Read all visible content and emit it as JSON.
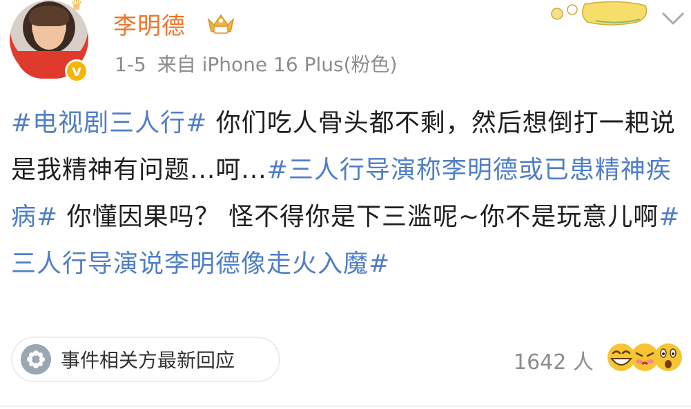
{
  "post": {
    "author": {
      "name": "李明德",
      "verified": true
    },
    "meta": {
      "time": "1-5",
      "source": "来自 iPhone 16 Plus(粉色)"
    },
    "segments": [
      {
        "type": "hashtag",
        "text": "#电视剧三人行#"
      },
      {
        "type": "text",
        "text": " 你们吃人骨头都不剩，然后想倒打一耙说是我精神有问题...呵..."
      },
      {
        "type": "hashtag",
        "text": "#三人行导演称李明德或已患精神疾病#"
      },
      {
        "type": "text",
        "text": " 你懂因果吗？ 怪不得你是下三滥呢~你不是玩意儿啊"
      },
      {
        "type": "hashtag",
        "text": "#三人行导演说李明德像走火入魔#"
      }
    ],
    "related": {
      "label": "事件相关方最新回应"
    },
    "reactions": {
      "count_label": "1642 人"
    }
  },
  "colors": {
    "username": "#f1742a",
    "hashtag": "#4f7ec7",
    "body_text": "#1e1e1e",
    "meta_text": "#8c8c8c",
    "verified": "#f6b500"
  },
  "icons": {
    "verified": "verified-v-icon",
    "vip": "vip-crown-icon",
    "sticker": "vlog-sticker-icon",
    "more": "chevron-down-icon",
    "related": "flower-icon",
    "reactions": "emoji-reactions-icon"
  }
}
